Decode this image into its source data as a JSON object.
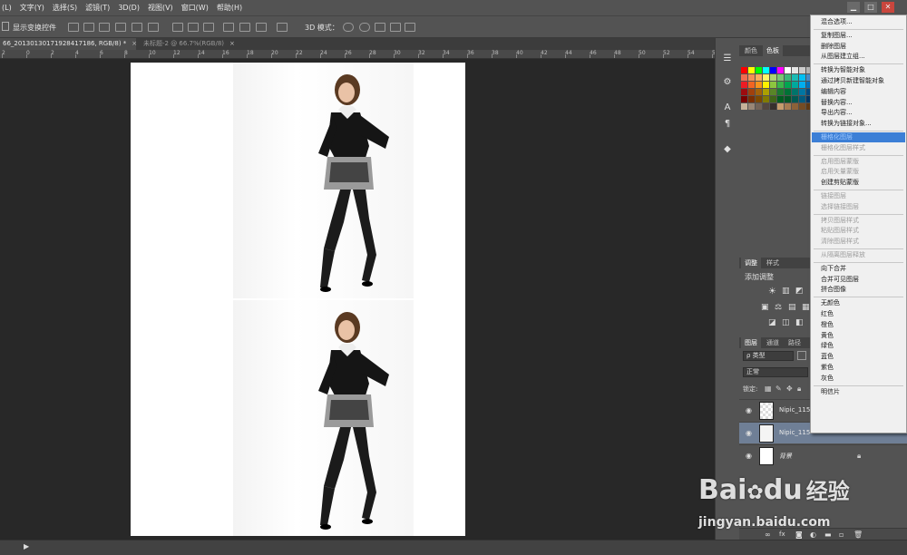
{
  "menubar": {
    "items": [
      "(L)",
      "文字(Y)",
      "选择(S)",
      "滤镜(T)",
      "3D(D)",
      "视图(V)",
      "窗口(W)",
      "帮助(H)"
    ],
    "window_buttons": [
      "▁",
      "□",
      "✕"
    ]
  },
  "options_bar": {
    "show_transform_controls": "显示变换控件",
    "mode_3d_label": "3D 模式："
  },
  "tabs": [
    {
      "label": "66_20130130171928417186, RGB/8) *",
      "close": "×",
      "active": true
    },
    {
      "label": "未标题-2 @ 66.7%(RGB/8)",
      "close": "×",
      "active": false
    }
  ],
  "ruler": {
    "labels": [
      "2",
      "0",
      "2",
      "4",
      "6",
      "8",
      "10",
      "12",
      "14",
      "16",
      "18",
      "20",
      "22",
      "24",
      "26",
      "28",
      "30",
      "32",
      "34",
      "36",
      "38",
      "40",
      "42",
      "44",
      "46",
      "48",
      "50",
      "52",
      "54",
      "56"
    ]
  },
  "color_panel": {
    "tabs": [
      "颜色",
      "色板"
    ],
    "selected_tab": "色板",
    "swatch_colors": [
      "#ff0000",
      "#ffff00",
      "#00ff00",
      "#00ffff",
      "#0000ff",
      "#ff00ff",
      "#ffffff",
      "#e6e6e6",
      "#cccccc",
      "#b3b3b3",
      "#999999",
      "#808080",
      "#f26c4f",
      "#f68e56",
      "#fbaf5d",
      "#fff467",
      "#acd372",
      "#7cc576",
      "#3bb878",
      "#1abbb4",
      "#00bff3",
      "#438cca",
      "#5574b9",
      "#605ca8",
      "#ed1c24",
      "#f26522",
      "#f7941d",
      "#fff200",
      "#8dc63f",
      "#39b54a",
      "#00a651",
      "#00a99d",
      "#00aeef",
      "#0072bc",
      "#0054a6",
      "#2e3192",
      "#9e0b0f",
      "#a0410d",
      "#a36209",
      "#aba000",
      "#598527",
      "#1a7b30",
      "#007236",
      "#00746b",
      "#0076a3",
      "#004b80",
      "#003471",
      "#1b1464",
      "#790000",
      "#7b2e00",
      "#7d4900",
      "#827b00",
      "#406618",
      "#005e20",
      "#005826",
      "#005952",
      "#005b7f",
      "#003663",
      "#002157",
      "#0d004c",
      "#c7b299",
      "#998675",
      "#736357",
      "#534741",
      "#37302d",
      "#c69c6d",
      "#a67c52",
      "#8c6239",
      "#754c24",
      "#603913",
      "#2e1a0d",
      "#140a05"
    ]
  },
  "adjust_panel": {
    "tabs": [
      "调整",
      "样式"
    ],
    "add_label": "添加调整"
  },
  "layers_panel": {
    "tabs": [
      "图层",
      "通道",
      "路径"
    ],
    "filter_kind": "ρ 类型",
    "blend_mode": "正常",
    "lock_label": "锁定:",
    "layers": [
      {
        "name": "Nipic_115",
        "visible": true,
        "selected": false
      },
      {
        "name": "Nipic_115",
        "visible": true,
        "selected": true
      },
      {
        "name": "背景",
        "visible": true,
        "selected": false
      }
    ],
    "footer_icons": [
      "link-icon",
      "fx-icon",
      "mask-icon",
      "adjustment-icon",
      "group-icon",
      "new-layer-icon",
      "trash-icon"
    ]
  },
  "context_menu": {
    "items": [
      {
        "label": "混合选项...",
        "enabled": true
      },
      {
        "sep": true
      },
      {
        "label": "复制图层...",
        "enabled": true
      },
      {
        "label": "删除图层",
        "enabled": true
      },
      {
        "label": "从图层建立组...",
        "enabled": true
      },
      {
        "sep": true
      },
      {
        "label": "转换为智能对象",
        "enabled": true
      },
      {
        "label": "通过拷贝新建智能对象",
        "enabled": true
      },
      {
        "label": "编辑内容",
        "enabled": true
      },
      {
        "label": "替换内容...",
        "enabled": true
      },
      {
        "label": "导出内容...",
        "enabled": true
      },
      {
        "label": "转换为链接对象...",
        "enabled": true
      },
      {
        "sep": true
      },
      {
        "label": "栅格化图层",
        "enabled": true,
        "highlighted": true
      },
      {
        "label": "栅格化图层样式",
        "enabled": false
      },
      {
        "sep": true
      },
      {
        "label": "启用图层蒙版",
        "enabled": false
      },
      {
        "label": "启用矢量蒙版",
        "enabled": false
      },
      {
        "label": "创建剪贴蒙版",
        "enabled": true
      },
      {
        "sep": true
      },
      {
        "label": "链接图层",
        "enabled": false
      },
      {
        "label": "选择链接图层",
        "enabled": false
      },
      {
        "sep": true
      },
      {
        "label": "拷贝图层样式",
        "enabled": false
      },
      {
        "label": "粘贴图层样式",
        "enabled": false
      },
      {
        "label": "清除图层样式",
        "enabled": false
      },
      {
        "sep": true
      },
      {
        "label": "从隔离图层释放",
        "enabled": false
      },
      {
        "sep": true
      },
      {
        "label": "向下合并",
        "enabled": true
      },
      {
        "label": "合并可见图层",
        "enabled": true
      },
      {
        "label": "拼合图像",
        "enabled": true
      },
      {
        "sep": true
      },
      {
        "label": "无颜色",
        "enabled": true
      },
      {
        "label": "红色",
        "enabled": true
      },
      {
        "label": "橙色",
        "enabled": true
      },
      {
        "label": "黄色",
        "enabled": true
      },
      {
        "label": "绿色",
        "enabled": true
      },
      {
        "label": "蓝色",
        "enabled": true
      },
      {
        "label": "紫色",
        "enabled": true
      },
      {
        "label": "灰色",
        "enabled": true
      },
      {
        "sep": true
      },
      {
        "label": "明信片",
        "enabled": true
      }
    ]
  },
  "watermark": {
    "brand": "Bai",
    "brand2": "du",
    "cn": "经验",
    "url": "jingyan.baidu.com"
  }
}
